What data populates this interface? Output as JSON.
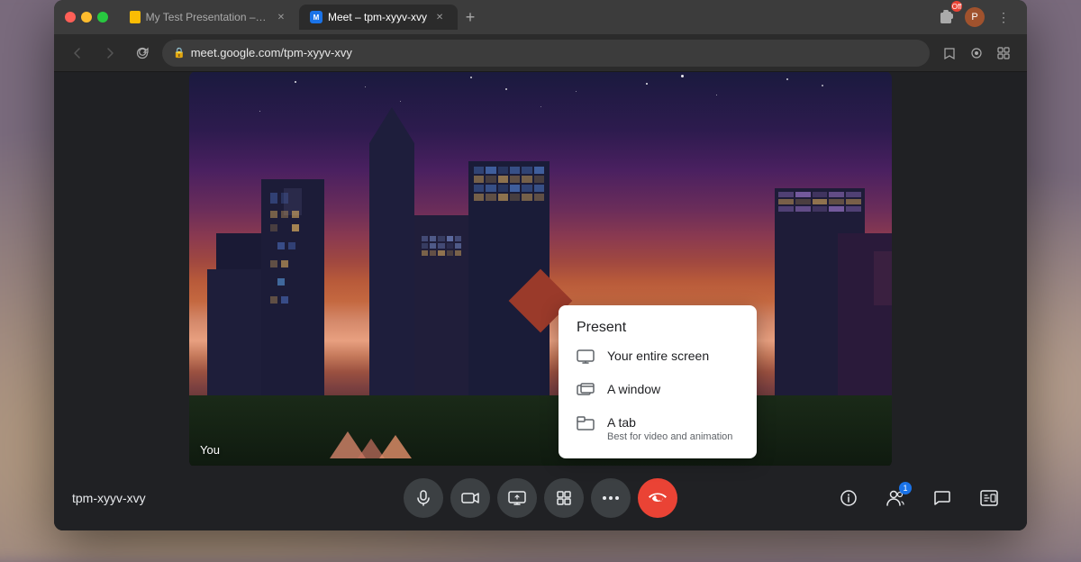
{
  "browser": {
    "tabs": [
      {
        "id": "slides-tab",
        "title": "My Test Presentation – Google",
        "favicon_type": "slides",
        "active": false
      },
      {
        "id": "meet-tab",
        "title": "Meet – tpm-xyyv-xvy",
        "favicon_type": "meet",
        "active": true
      }
    ],
    "new_tab_label": "+",
    "address": "meet.google.com/tpm-xyyv-xvy"
  },
  "nav": {
    "back_label": "←",
    "forward_label": "→",
    "reload_label": "↺"
  },
  "meeting": {
    "code": "tpm-xyyv-xvy",
    "participant_label": "You"
  },
  "toolbar": {
    "mic_label": "Microphone",
    "camera_label": "Camera",
    "present_label": "Present",
    "effects_label": "Effects",
    "more_label": "More options",
    "end_call_label": "End call",
    "info_label": "Meeting details",
    "people_label": "People",
    "chat_label": "Chat",
    "activities_label": "Activities",
    "people_count": "1"
  },
  "present_menu": {
    "title": "Present",
    "items": [
      {
        "id": "entire-screen",
        "label": "Your entire screen",
        "sublabel": "",
        "icon": "monitor"
      },
      {
        "id": "a-window",
        "label": "A window",
        "sublabel": "",
        "icon": "window"
      },
      {
        "id": "a-tab",
        "label": "A tab",
        "sublabel": "Best for video and animation",
        "icon": "tab"
      }
    ]
  }
}
